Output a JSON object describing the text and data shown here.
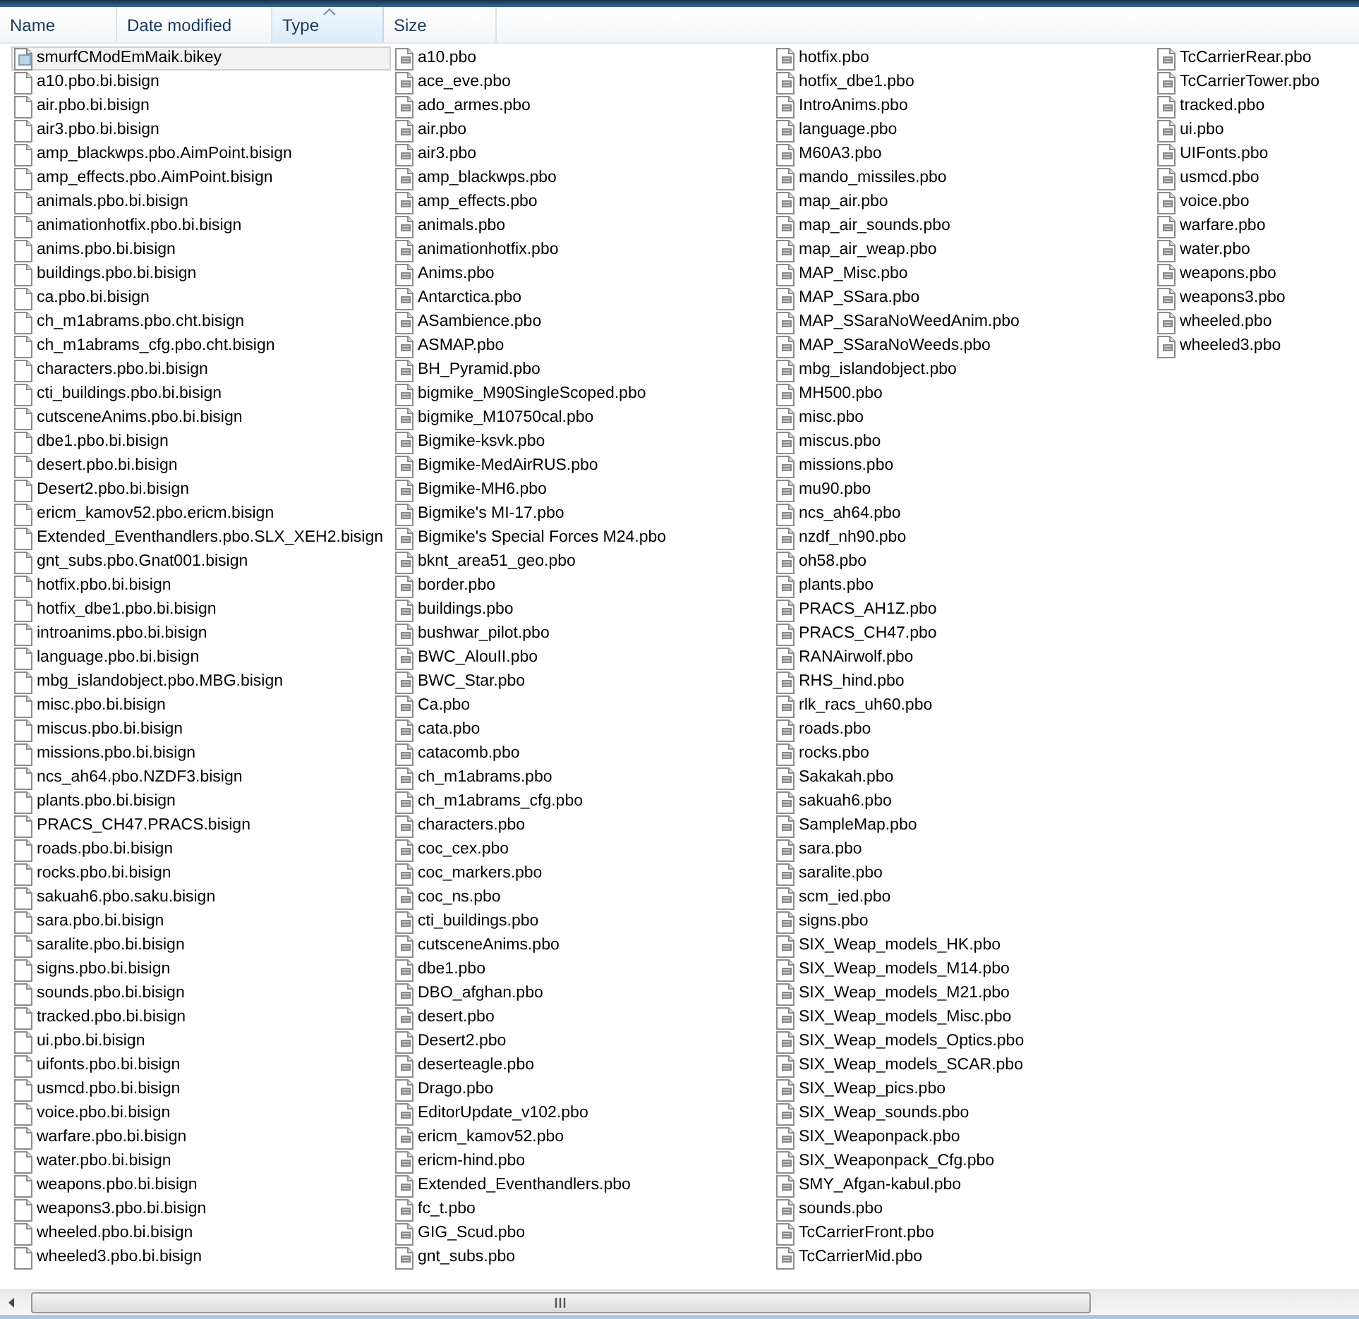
{
  "columns": [
    {
      "label": "Name",
      "sorted": false
    },
    {
      "label": "Date modified",
      "sorted": false
    },
    {
      "label": "Type",
      "sorted": true
    },
    {
      "label": "Size",
      "sorted": false
    }
  ],
  "files": [
    {
      "name": "smurfCModEmMaik.bikey",
      "kind": "bikey",
      "selected": true
    },
    {
      "name": "a10.pbo.bi.bisign",
      "kind": "bisign",
      "selected": false
    },
    {
      "name": "air.pbo.bi.bisign",
      "kind": "bisign",
      "selected": false
    },
    {
      "name": "air3.pbo.bi.bisign",
      "kind": "bisign",
      "selected": false
    },
    {
      "name": "amp_blackwps.pbo.AimPoint.bisign",
      "kind": "bisign",
      "selected": false
    },
    {
      "name": "amp_effects.pbo.AimPoint.bisign",
      "kind": "bisign",
      "selected": false
    },
    {
      "name": "animals.pbo.bi.bisign",
      "kind": "bisign",
      "selected": false
    },
    {
      "name": "animationhotfix.pbo.bi.bisign",
      "kind": "bisign",
      "selected": false
    },
    {
      "name": "anims.pbo.bi.bisign",
      "kind": "bisign",
      "selected": false
    },
    {
      "name": "buildings.pbo.bi.bisign",
      "kind": "bisign",
      "selected": false
    },
    {
      "name": "ca.pbo.bi.bisign",
      "kind": "bisign",
      "selected": false
    },
    {
      "name": "ch_m1abrams.pbo.cht.bisign",
      "kind": "bisign",
      "selected": false
    },
    {
      "name": "ch_m1abrams_cfg.pbo.cht.bisign",
      "kind": "bisign",
      "selected": false
    },
    {
      "name": "characters.pbo.bi.bisign",
      "kind": "bisign",
      "selected": false
    },
    {
      "name": "cti_buildings.pbo.bi.bisign",
      "kind": "bisign",
      "selected": false
    },
    {
      "name": "cutsceneAnims.pbo.bi.bisign",
      "kind": "bisign",
      "selected": false
    },
    {
      "name": "dbe1.pbo.bi.bisign",
      "kind": "bisign",
      "selected": false
    },
    {
      "name": "desert.pbo.bi.bisign",
      "kind": "bisign",
      "selected": false
    },
    {
      "name": "Desert2.pbo.bi.bisign",
      "kind": "bisign",
      "selected": false
    },
    {
      "name": "ericm_kamov52.pbo.ericm.bisign",
      "kind": "bisign",
      "selected": false
    },
    {
      "name": "Extended_Eventhandlers.pbo.SLX_XEH2.bisign",
      "kind": "bisign",
      "selected": false
    },
    {
      "name": "gnt_subs.pbo.Gnat001.bisign",
      "kind": "bisign",
      "selected": false
    },
    {
      "name": "hotfix.pbo.bi.bisign",
      "kind": "bisign",
      "selected": false
    },
    {
      "name": "hotfix_dbe1.pbo.bi.bisign",
      "kind": "bisign",
      "selected": false
    },
    {
      "name": "introanims.pbo.bi.bisign",
      "kind": "bisign",
      "selected": false
    },
    {
      "name": "language.pbo.bi.bisign",
      "kind": "bisign",
      "selected": false
    },
    {
      "name": "mbg_islandobject.pbo.MBG.bisign",
      "kind": "bisign",
      "selected": false
    },
    {
      "name": "misc.pbo.bi.bisign",
      "kind": "bisign",
      "selected": false
    },
    {
      "name": "miscus.pbo.bi.bisign",
      "kind": "bisign",
      "selected": false
    },
    {
      "name": "missions.pbo.bi.bisign",
      "kind": "bisign",
      "selected": false
    },
    {
      "name": "ncs_ah64.pbo.NZDF3.bisign",
      "kind": "bisign",
      "selected": false
    },
    {
      "name": "plants.pbo.bi.bisign",
      "kind": "bisign",
      "selected": false
    },
    {
      "name": "PRACS_CH47.PRACS.bisign",
      "kind": "bisign",
      "selected": false
    },
    {
      "name": "roads.pbo.bi.bisign",
      "kind": "bisign",
      "selected": false
    },
    {
      "name": "rocks.pbo.bi.bisign",
      "kind": "bisign",
      "selected": false
    },
    {
      "name": "sakuah6.pbo.saku.bisign",
      "kind": "bisign",
      "selected": false
    },
    {
      "name": "sara.pbo.bi.bisign",
      "kind": "bisign",
      "selected": false
    },
    {
      "name": "saralite.pbo.bi.bisign",
      "kind": "bisign",
      "selected": false
    },
    {
      "name": "signs.pbo.bi.bisign",
      "kind": "bisign",
      "selected": false
    },
    {
      "name": "sounds.pbo.bi.bisign",
      "kind": "bisign",
      "selected": false
    },
    {
      "name": "tracked.pbo.bi.bisign",
      "kind": "bisign",
      "selected": false
    },
    {
      "name": "ui.pbo.bi.bisign",
      "kind": "bisign",
      "selected": false
    },
    {
      "name": "uifonts.pbo.bi.bisign",
      "kind": "bisign",
      "selected": false
    },
    {
      "name": "usmcd.pbo.bi.bisign",
      "kind": "bisign",
      "selected": false
    },
    {
      "name": "voice.pbo.bi.bisign",
      "kind": "bisign",
      "selected": false
    },
    {
      "name": "warfare.pbo.bi.bisign",
      "kind": "bisign",
      "selected": false
    },
    {
      "name": "water.pbo.bi.bisign",
      "kind": "bisign",
      "selected": false
    },
    {
      "name": "weapons.pbo.bi.bisign",
      "kind": "bisign",
      "selected": false
    },
    {
      "name": "weapons3.pbo.bi.bisign",
      "kind": "bisign",
      "selected": false
    },
    {
      "name": "wheeled.pbo.bi.bisign",
      "kind": "bisign",
      "selected": false
    },
    {
      "name": "wheeled3.pbo.bi.bisign",
      "kind": "bisign",
      "selected": false
    },
    {
      "name": "a10.pbo",
      "kind": "pbo",
      "selected": false
    },
    {
      "name": "ace_eve.pbo",
      "kind": "pbo",
      "selected": false
    },
    {
      "name": "ado_armes.pbo",
      "kind": "pbo",
      "selected": false
    },
    {
      "name": "air.pbo",
      "kind": "pbo",
      "selected": false
    },
    {
      "name": "air3.pbo",
      "kind": "pbo",
      "selected": false
    },
    {
      "name": "amp_blackwps.pbo",
      "kind": "pbo",
      "selected": false
    },
    {
      "name": "amp_effects.pbo",
      "kind": "pbo",
      "selected": false
    },
    {
      "name": "animals.pbo",
      "kind": "pbo",
      "selected": false
    },
    {
      "name": "animationhotfix.pbo",
      "kind": "pbo",
      "selected": false
    },
    {
      "name": "Anims.pbo",
      "kind": "pbo",
      "selected": false
    },
    {
      "name": "Antarctica.pbo",
      "kind": "pbo",
      "selected": false
    },
    {
      "name": "ASambience.pbo",
      "kind": "pbo",
      "selected": false
    },
    {
      "name": "ASMAP.pbo",
      "kind": "pbo",
      "selected": false
    },
    {
      "name": "BH_Pyramid.pbo",
      "kind": "pbo",
      "selected": false
    },
    {
      "name": "bigmike_M90SingleScoped.pbo",
      "kind": "pbo",
      "selected": false
    },
    {
      "name": "bigmike_M10750cal.pbo",
      "kind": "pbo",
      "selected": false
    },
    {
      "name": "Bigmike-ksvk.pbo",
      "kind": "pbo",
      "selected": false
    },
    {
      "name": "Bigmike-MedAirRUS.pbo",
      "kind": "pbo",
      "selected": false
    },
    {
      "name": "Bigmike-MH6.pbo",
      "kind": "pbo",
      "selected": false
    },
    {
      "name": "Bigmike's MI-17.pbo",
      "kind": "pbo",
      "selected": false
    },
    {
      "name": "Bigmike's Special Forces M24.pbo",
      "kind": "pbo",
      "selected": false
    },
    {
      "name": "bknt_area51_geo.pbo",
      "kind": "pbo",
      "selected": false
    },
    {
      "name": "border.pbo",
      "kind": "pbo",
      "selected": false
    },
    {
      "name": "buildings.pbo",
      "kind": "pbo",
      "selected": false
    },
    {
      "name": "bushwar_pilot.pbo",
      "kind": "pbo",
      "selected": false
    },
    {
      "name": "BWC_AlouII.pbo",
      "kind": "pbo",
      "selected": false
    },
    {
      "name": "BWC_Star.pbo",
      "kind": "pbo",
      "selected": false
    },
    {
      "name": "Ca.pbo",
      "kind": "pbo",
      "selected": false
    },
    {
      "name": "cata.pbo",
      "kind": "pbo",
      "selected": false
    },
    {
      "name": "catacomb.pbo",
      "kind": "pbo",
      "selected": false
    },
    {
      "name": "ch_m1abrams.pbo",
      "kind": "pbo",
      "selected": false
    },
    {
      "name": "ch_m1abrams_cfg.pbo",
      "kind": "pbo",
      "selected": false
    },
    {
      "name": "characters.pbo",
      "kind": "pbo",
      "selected": false
    },
    {
      "name": "coc_cex.pbo",
      "kind": "pbo",
      "selected": false
    },
    {
      "name": "coc_markers.pbo",
      "kind": "pbo",
      "selected": false
    },
    {
      "name": "coc_ns.pbo",
      "kind": "pbo",
      "selected": false
    },
    {
      "name": "cti_buildings.pbo",
      "kind": "pbo",
      "selected": false
    },
    {
      "name": "cutsceneAnims.pbo",
      "kind": "pbo",
      "selected": false
    },
    {
      "name": "dbe1.pbo",
      "kind": "pbo",
      "selected": false
    },
    {
      "name": "DBO_afghan.pbo",
      "kind": "pbo",
      "selected": false
    },
    {
      "name": "desert.pbo",
      "kind": "pbo",
      "selected": false
    },
    {
      "name": "Desert2.pbo",
      "kind": "pbo",
      "selected": false
    },
    {
      "name": "deserteagle.pbo",
      "kind": "pbo",
      "selected": false
    },
    {
      "name": "Drago.pbo",
      "kind": "pbo",
      "selected": false
    },
    {
      "name": "EditorUpdate_v102.pbo",
      "kind": "pbo",
      "selected": false
    },
    {
      "name": "ericm_kamov52.pbo",
      "kind": "pbo",
      "selected": false
    },
    {
      "name": "ericm-hind.pbo",
      "kind": "pbo",
      "selected": false
    },
    {
      "name": "Extended_Eventhandlers.pbo",
      "kind": "pbo",
      "selected": false
    },
    {
      "name": "fc_t.pbo",
      "kind": "pbo",
      "selected": false
    },
    {
      "name": "GIG_Scud.pbo",
      "kind": "pbo",
      "selected": false
    },
    {
      "name": "gnt_subs.pbo",
      "kind": "pbo",
      "selected": false
    },
    {
      "name": "hotfix.pbo",
      "kind": "pbo",
      "selected": false
    },
    {
      "name": "hotfix_dbe1.pbo",
      "kind": "pbo",
      "selected": false
    },
    {
      "name": "IntroAnims.pbo",
      "kind": "pbo",
      "selected": false
    },
    {
      "name": "language.pbo",
      "kind": "pbo",
      "selected": false
    },
    {
      "name": "M60A3.pbo",
      "kind": "pbo",
      "selected": false
    },
    {
      "name": "mando_missiles.pbo",
      "kind": "pbo",
      "selected": false
    },
    {
      "name": "map_air.pbo",
      "kind": "pbo",
      "selected": false
    },
    {
      "name": "map_air_sounds.pbo",
      "kind": "pbo",
      "selected": false
    },
    {
      "name": "map_air_weap.pbo",
      "kind": "pbo",
      "selected": false
    },
    {
      "name": "MAP_Misc.pbo",
      "kind": "pbo",
      "selected": false
    },
    {
      "name": "MAP_SSara.pbo",
      "kind": "pbo",
      "selected": false
    },
    {
      "name": "MAP_SSaraNoWeedAnim.pbo",
      "kind": "pbo",
      "selected": false
    },
    {
      "name": "MAP_SSaraNoWeeds.pbo",
      "kind": "pbo",
      "selected": false
    },
    {
      "name": "mbg_islandobject.pbo",
      "kind": "pbo",
      "selected": false
    },
    {
      "name": "MH500.pbo",
      "kind": "pbo",
      "selected": false
    },
    {
      "name": "misc.pbo",
      "kind": "pbo",
      "selected": false
    },
    {
      "name": "miscus.pbo",
      "kind": "pbo",
      "selected": false
    },
    {
      "name": "missions.pbo",
      "kind": "pbo",
      "selected": false
    },
    {
      "name": "mu90.pbo",
      "kind": "pbo",
      "selected": false
    },
    {
      "name": "ncs_ah64.pbo",
      "kind": "pbo",
      "selected": false
    },
    {
      "name": "nzdf_nh90.pbo",
      "kind": "pbo",
      "selected": false
    },
    {
      "name": "oh58.pbo",
      "kind": "pbo",
      "selected": false
    },
    {
      "name": "plants.pbo",
      "kind": "pbo",
      "selected": false
    },
    {
      "name": "PRACS_AH1Z.pbo",
      "kind": "pbo",
      "selected": false
    },
    {
      "name": "PRACS_CH47.pbo",
      "kind": "pbo",
      "selected": false
    },
    {
      "name": "RANAirwolf.pbo",
      "kind": "pbo",
      "selected": false
    },
    {
      "name": "RHS_hind.pbo",
      "kind": "pbo",
      "selected": false
    },
    {
      "name": "rlk_racs_uh60.pbo",
      "kind": "pbo",
      "selected": false
    },
    {
      "name": "roads.pbo",
      "kind": "pbo",
      "selected": false
    },
    {
      "name": "rocks.pbo",
      "kind": "pbo",
      "selected": false
    },
    {
      "name": "Sakakah.pbo",
      "kind": "pbo",
      "selected": false
    },
    {
      "name": "sakuah6.pbo",
      "kind": "pbo",
      "selected": false
    },
    {
      "name": "SampleMap.pbo",
      "kind": "pbo",
      "selected": false
    },
    {
      "name": "sara.pbo",
      "kind": "pbo",
      "selected": false
    },
    {
      "name": "saralite.pbo",
      "kind": "pbo",
      "selected": false
    },
    {
      "name": "scm_ied.pbo",
      "kind": "pbo",
      "selected": false
    },
    {
      "name": "signs.pbo",
      "kind": "pbo",
      "selected": false
    },
    {
      "name": "SIX_Weap_models_HK.pbo",
      "kind": "pbo",
      "selected": false
    },
    {
      "name": "SIX_Weap_models_M14.pbo",
      "kind": "pbo",
      "selected": false
    },
    {
      "name": "SIX_Weap_models_M21.pbo",
      "kind": "pbo",
      "selected": false
    },
    {
      "name": "SIX_Weap_models_Misc.pbo",
      "kind": "pbo",
      "selected": false
    },
    {
      "name": "SIX_Weap_models_Optics.pbo",
      "kind": "pbo",
      "selected": false
    },
    {
      "name": "SIX_Weap_models_SCAR.pbo",
      "kind": "pbo",
      "selected": false
    },
    {
      "name": "SIX_Weap_pics.pbo",
      "kind": "pbo",
      "selected": false
    },
    {
      "name": "SIX_Weap_sounds.pbo",
      "kind": "pbo",
      "selected": false
    },
    {
      "name": "SIX_Weaponpack.pbo",
      "kind": "pbo",
      "selected": false
    },
    {
      "name": "SIX_Weaponpack_Cfg.pbo",
      "kind": "pbo",
      "selected": false
    },
    {
      "name": "SMY_Afgan-kabul.pbo",
      "kind": "pbo",
      "selected": false
    },
    {
      "name": "sounds.pbo",
      "kind": "pbo",
      "selected": false
    },
    {
      "name": "TcCarrierFront.pbo",
      "kind": "pbo",
      "selected": false
    },
    {
      "name": "TcCarrierMid.pbo",
      "kind": "pbo",
      "selected": false
    },
    {
      "name": "TcCarrierRear.pbo",
      "kind": "pbo",
      "selected": false
    },
    {
      "name": "TcCarrierTower.pbo",
      "kind": "pbo",
      "selected": false
    },
    {
      "name": "tracked.pbo",
      "kind": "pbo",
      "selected": false
    },
    {
      "name": "ui.pbo",
      "kind": "pbo",
      "selected": false
    },
    {
      "name": "UIFonts.pbo",
      "kind": "pbo",
      "selected": false
    },
    {
      "name": "usmcd.pbo",
      "kind": "pbo",
      "selected": false
    },
    {
      "name": "voice.pbo",
      "kind": "pbo",
      "selected": false
    },
    {
      "name": "warfare.pbo",
      "kind": "pbo",
      "selected": false
    },
    {
      "name": "water.pbo",
      "kind": "pbo",
      "selected": false
    },
    {
      "name": "weapons.pbo",
      "kind": "pbo",
      "selected": false
    },
    {
      "name": "weapons3.pbo",
      "kind": "pbo",
      "selected": false
    },
    {
      "name": "wheeled.pbo",
      "kind": "pbo",
      "selected": false
    },
    {
      "name": "wheeled3.pbo",
      "kind": "pbo",
      "selected": false
    }
  ]
}
